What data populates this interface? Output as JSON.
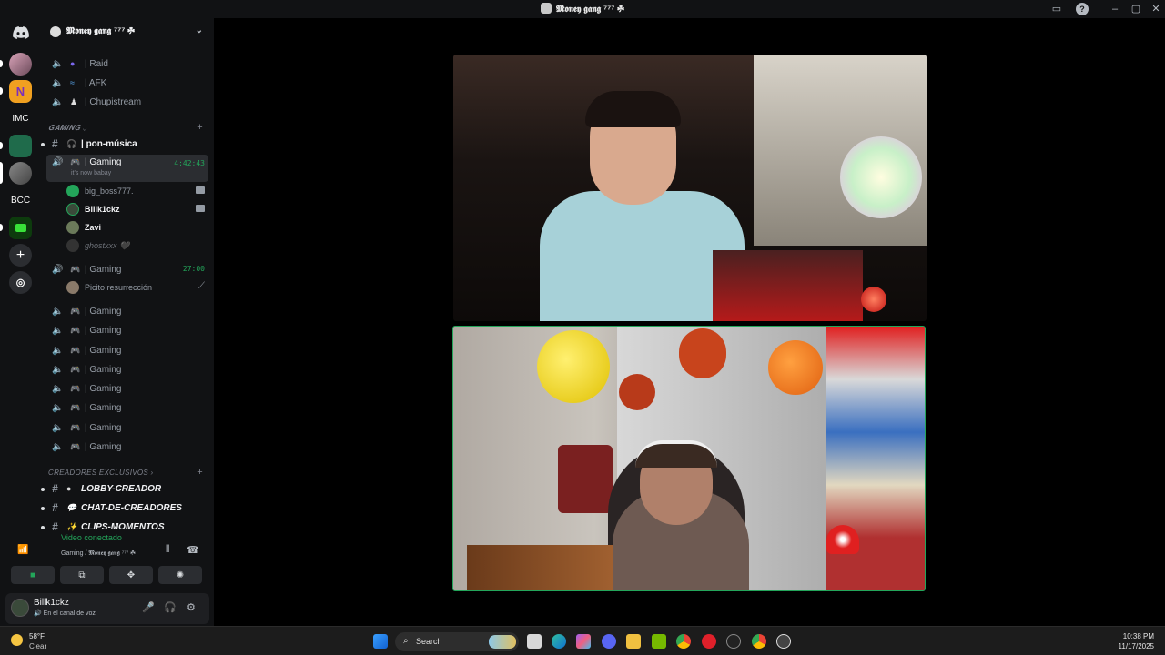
{
  "window": {
    "title": "𝕸𝖔𝖓𝖊𝖞 𝖌𝖆𝖓𝖌 ⁷⁷⁷ ☘"
  },
  "rail": {
    "servers": [
      {
        "name": "discord-home-icon",
        "label": ""
      },
      {
        "name": "server-avatar-1",
        "label": ""
      },
      {
        "name": "server-n",
        "label": "N"
      },
      {
        "name": "server-imc",
        "label": "IMC"
      },
      {
        "name": "server-4",
        "label": ""
      },
      {
        "name": "server-money-gang",
        "label": ""
      },
      {
        "name": "server-bcc",
        "label": "BCC"
      },
      {
        "name": "server-7",
        "label": ""
      }
    ]
  },
  "server": {
    "name": "𝕸𝖔𝖓𝖊𝖞 𝖌𝖆𝖓𝖌 ⁷⁷⁷ ☘"
  },
  "channels": {
    "top_voice": [
      {
        "label": "| Raid"
      },
      {
        "label": "| AFK"
      },
      {
        "label": "| Chupistream"
      }
    ],
    "gaming_category": "𝑮𝑨𝑴𝑰𝑵𝑮",
    "pon_musica": "| pon-música",
    "active": {
      "label": "| Gaming",
      "timer": "4:42:43",
      "status": "it's now babay"
    },
    "active_users": [
      {
        "name": "big_boss777."
      },
      {
        "name": "Billk1ckz"
      },
      {
        "name": "Zavi"
      },
      {
        "name": "ghostxxx 🖤"
      }
    ],
    "second_gaming": {
      "label": "| Gaming",
      "timer": "27:00"
    },
    "second_users": [
      {
        "name": "Picito resurrección"
      }
    ],
    "more_gaming": [
      "| Gaming",
      "| Gaming",
      "| Gaming",
      "| Gaming",
      "| Gaming",
      "| Gaming",
      "| Gaming",
      "| Gaming"
    ],
    "creators_category": "CREADORES EXCLUSIVOS",
    "creators": [
      "LOBBY-CREADOR",
      "CHAT-DE-CREADORES",
      "CLIPS-MOMENTOS"
    ]
  },
  "voice": {
    "status": "Video conectado",
    "location": "Gaming / 𝕸𝖔𝖓𝖊𝖞 𝖌𝖆𝖓𝖌 ⁷⁷⁷ ☘"
  },
  "user": {
    "name": "Billk1ckz",
    "status": "En el canal de voz"
  },
  "taskbar": {
    "temp": "58°F",
    "condition": "Clear",
    "search": "Search",
    "time": "10:38 PM",
    "date": "11/17/2025"
  },
  "colors": {
    "accent_green": "#23a55a",
    "bg": "#111214"
  }
}
